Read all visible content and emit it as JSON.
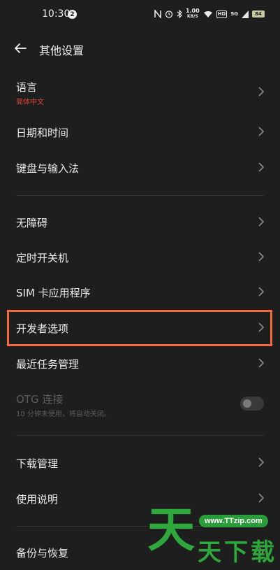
{
  "status_bar": {
    "time": "10:30",
    "notification_count": "2",
    "net_speed_value": "1.00",
    "net_speed_unit": "KB/S",
    "network_label": "5G",
    "hd_label": "HD",
    "battery": "84",
    "icons": [
      "nfc-icon",
      "alarm-icon",
      "bluetooth-icon",
      "wifi-icon",
      "signal-icon",
      "battery-icon"
    ]
  },
  "header": {
    "title": "其他设置"
  },
  "items": [
    {
      "label": "语言",
      "sub": "简体中文",
      "sub_color": "#d9463c"
    },
    {
      "label": "日期和时间"
    },
    {
      "label": "键盘与输入法"
    },
    {
      "label": "无障碍"
    },
    {
      "label": "定时开关机"
    },
    {
      "label": "SIM 卡应用程序"
    },
    {
      "label": "开发者选项"
    },
    {
      "label": "最近任务管理"
    },
    {
      "label": "OTG 连接",
      "sub": "10 分钟未使用，将自动关闭。",
      "disabled": true,
      "toggle_on": false
    },
    {
      "label": "下载管理"
    },
    {
      "label": "使用说明"
    },
    {
      "label": "备份与恢复"
    }
  ],
  "highlight_color": "#f26b3a",
  "watermark": {
    "url": "www.TTzip.com",
    "big_char": "天",
    "text": "天下载",
    "color": "#2ea83d"
  }
}
